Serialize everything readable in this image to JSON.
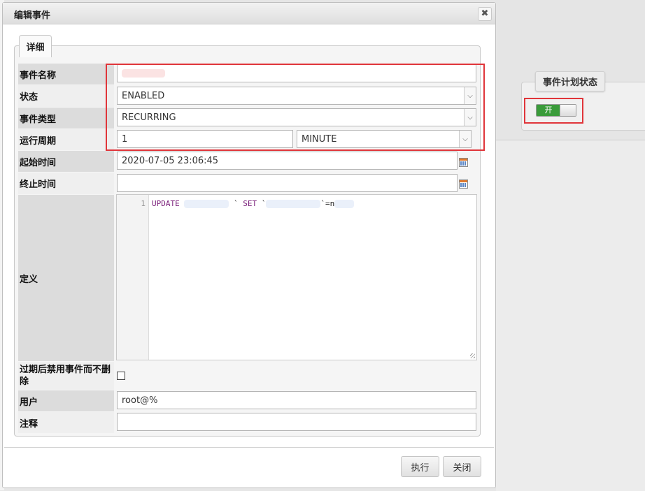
{
  "dialog": {
    "title": "编辑事件",
    "close_glyph": "✖",
    "section_legend": "详细"
  },
  "form": {
    "event_name": {
      "label": "事件名称",
      "value": ""
    },
    "status": {
      "label": "状态",
      "value": "ENABLED"
    },
    "event_type": {
      "label": "事件类型",
      "value": "RECURRING"
    },
    "run_interval": {
      "label": "运行周期",
      "value": "1",
      "unit": "MINUTE"
    },
    "start_time": {
      "label": "起始时间",
      "value": "2020-07-05 23:06:45"
    },
    "end_time": {
      "label": "终止时间",
      "value": ""
    },
    "definition": {
      "label": "定义",
      "line_number": "1",
      "code_keyword1": "UPDATE",
      "code_tick1": "`",
      "code_keyword2": "SET",
      "code_tick2": "`",
      "code_tail": "`=n"
    },
    "preserve": {
      "label": "过期后禁用事件而不删除",
      "checked": false
    },
    "definer": {
      "label": "用户",
      "value": "root@%"
    },
    "comment": {
      "label": "注释",
      "value": ""
    }
  },
  "buttons": {
    "execute": "执行",
    "close": "关闭"
  },
  "scheduler_status": {
    "legend": "事件计划状态",
    "toggle_label": "开",
    "state": "on"
  },
  "colors": {
    "highlight": "#e0353a",
    "toggle_on": "#3a9b3a"
  }
}
